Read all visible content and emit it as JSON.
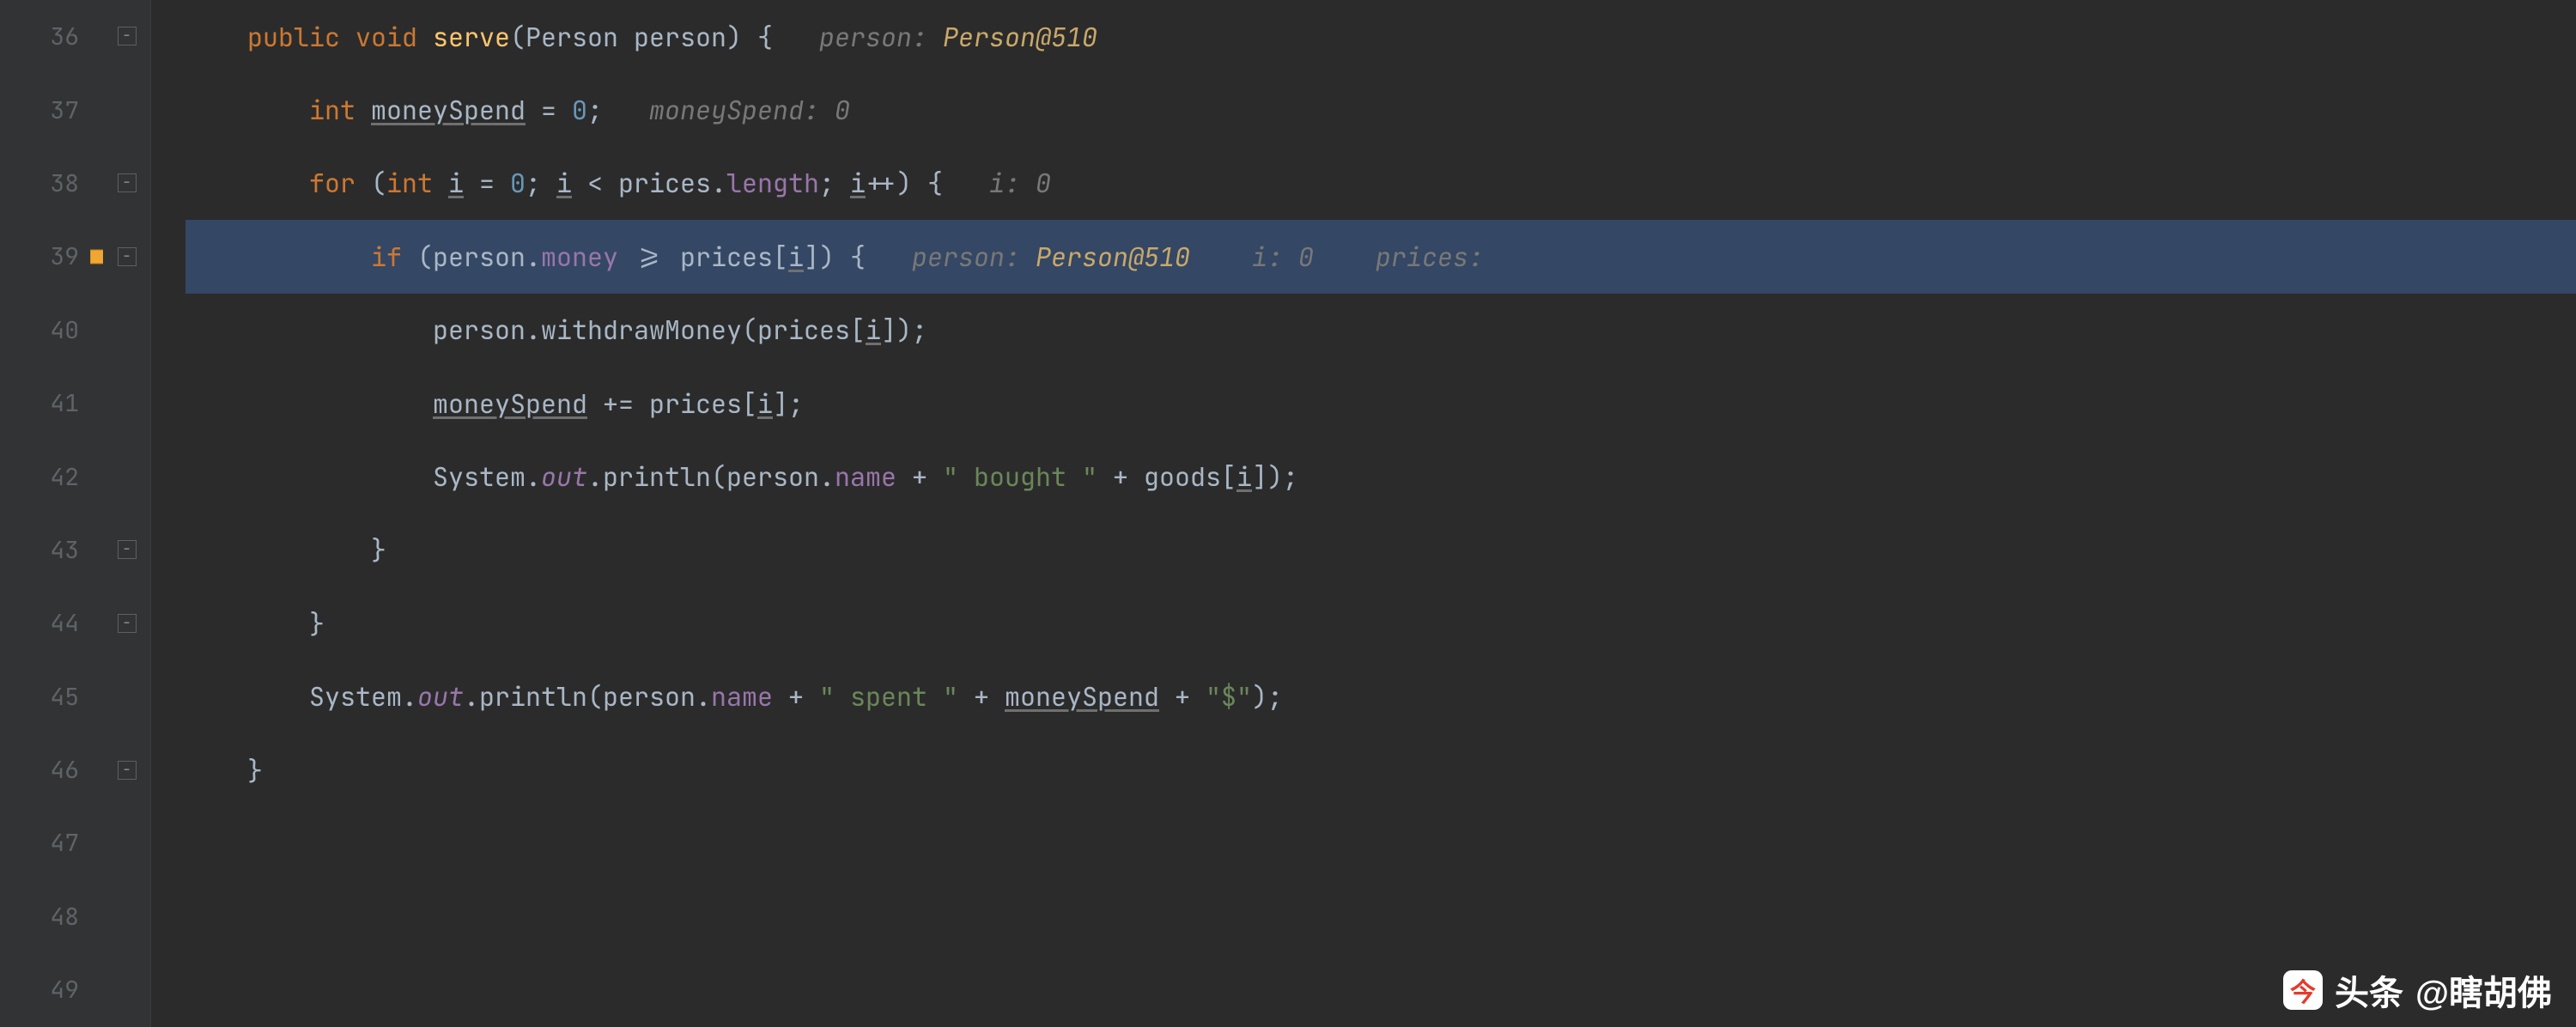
{
  "lines": {
    "start": 36,
    "end": 49,
    "current": 39
  },
  "fold_markers": [
    {
      "line": 36,
      "glyph": "−"
    },
    {
      "line": 38,
      "glyph": "−"
    },
    {
      "line": 39,
      "glyph": "−"
    },
    {
      "line": 43,
      "glyph": "−"
    },
    {
      "line": 44,
      "glyph": "−"
    },
    {
      "line": 46,
      "glyph": "−"
    }
  ],
  "exec_pointer_line": 39,
  "code": {
    "l36": {
      "indent": "    ",
      "kw1": "public",
      "sp1": " ",
      "kw2": "void",
      "sp2": " ",
      "mname": "serve",
      "open": "(",
      "ptype": "Person",
      "sp3": " ",
      "pname": "person",
      "close": ")",
      "sp4": " ",
      "brace": "{",
      "hint_gap": "   ",
      "hint_key": "person: ",
      "hint_val": "Person@510"
    },
    "l37": {
      "indent": "        ",
      "kw": "int",
      "sp1": " ",
      "var": "moneySpend",
      "sp2": " ",
      "eq": "=",
      "sp3": " ",
      "val": "0",
      "semi": ";",
      "hint_gap": "   ",
      "hint_key": "moneySpend: ",
      "hint_val": "0"
    },
    "l38": {
      "indent": "        ",
      "kw1": "for",
      "sp1": " ",
      "open": "(",
      "kw2": "int",
      "sp2": " ",
      "i1": "i",
      "sp3": " ",
      "eq": "=",
      "sp4": " ",
      "zero": "0",
      "semi1": ";",
      "sp5": " ",
      "i2": "i",
      "sp6": " ",
      "lt": "<",
      "sp7": " ",
      "arr": "prices",
      "dot": ".",
      "len": "length",
      "semi2": ";",
      "sp8": " ",
      "i3": "i",
      "inc": "++",
      "close": ")",
      "sp9": " ",
      "brace": "{",
      "hint_gap": "   ",
      "hint_key": "i: ",
      "hint_val": "0"
    },
    "l39": {
      "indent": "            ",
      "kw": "if",
      "sp1": " ",
      "open": "(",
      "obj": "person",
      "dot": ".",
      "fld": "money",
      "sp2": " ",
      "op": ">=",
      "sp3": " ",
      "arr": "prices",
      "lb": "[",
      "i": "i",
      "rb": "]",
      "close": ")",
      "sp4": " ",
      "brace": "{",
      "hint_gap": "   ",
      "h1k": "person: ",
      "h1v": "Person@510",
      "gap2": "    ",
      "h2k": "i: ",
      "h2v": "0",
      "gap3": "    ",
      "h3k": "prices: "
    },
    "l40": {
      "indent": "                ",
      "obj": "person",
      "dot": ".",
      "m": "withdrawMoney",
      "open": "(",
      "arr": "prices",
      "lb": "[",
      "i": "i",
      "rb": "]",
      "close": ")",
      "semi": ";"
    },
    "l41": {
      "indent": "                ",
      "var": "moneySpend",
      "sp1": " ",
      "op": "+=",
      "sp2": " ",
      "arr": "prices",
      "lb": "[",
      "i": "i",
      "rb": "]",
      "semi": ";"
    },
    "l42": {
      "indent": "                ",
      "sys": "System",
      "dot1": ".",
      "out": "out",
      "dot2": ".",
      "m": "println",
      "open": "(",
      "obj": "person",
      "dot3": ".",
      "fld": "name",
      "sp1": " ",
      "plus1": "+",
      "sp2": " ",
      "s1": "\" bought \"",
      "sp3": " ",
      "plus2": "+",
      "sp4": " ",
      "arr": "goods",
      "lb": "[",
      "i": "i",
      "rb": "]",
      "close": ")",
      "semi": ";"
    },
    "l43": {
      "indent": "            ",
      "brace": "}"
    },
    "l44": {
      "indent": "        ",
      "brace": "}"
    },
    "l45": {
      "indent": "        ",
      "sys": "System",
      "dot1": ".",
      "out": "out",
      "dot2": ".",
      "m": "println",
      "open": "(",
      "obj": "person",
      "dot3": ".",
      "fld": "name",
      "sp1": " ",
      "plus1": "+",
      "sp2": " ",
      "s1": "\" spent \"",
      "sp3": " ",
      "plus2": "+",
      "sp4": " ",
      "var": "moneySpend",
      "sp5": " ",
      "plus3": "+",
      "sp6": " ",
      "s2": "\"$\"",
      "close": ")",
      "semi": ";"
    },
    "l46": {
      "indent": "    ",
      "brace": "}"
    }
  },
  "watermark": {
    "label": "头条",
    "handle": "@瞎胡佛"
  }
}
